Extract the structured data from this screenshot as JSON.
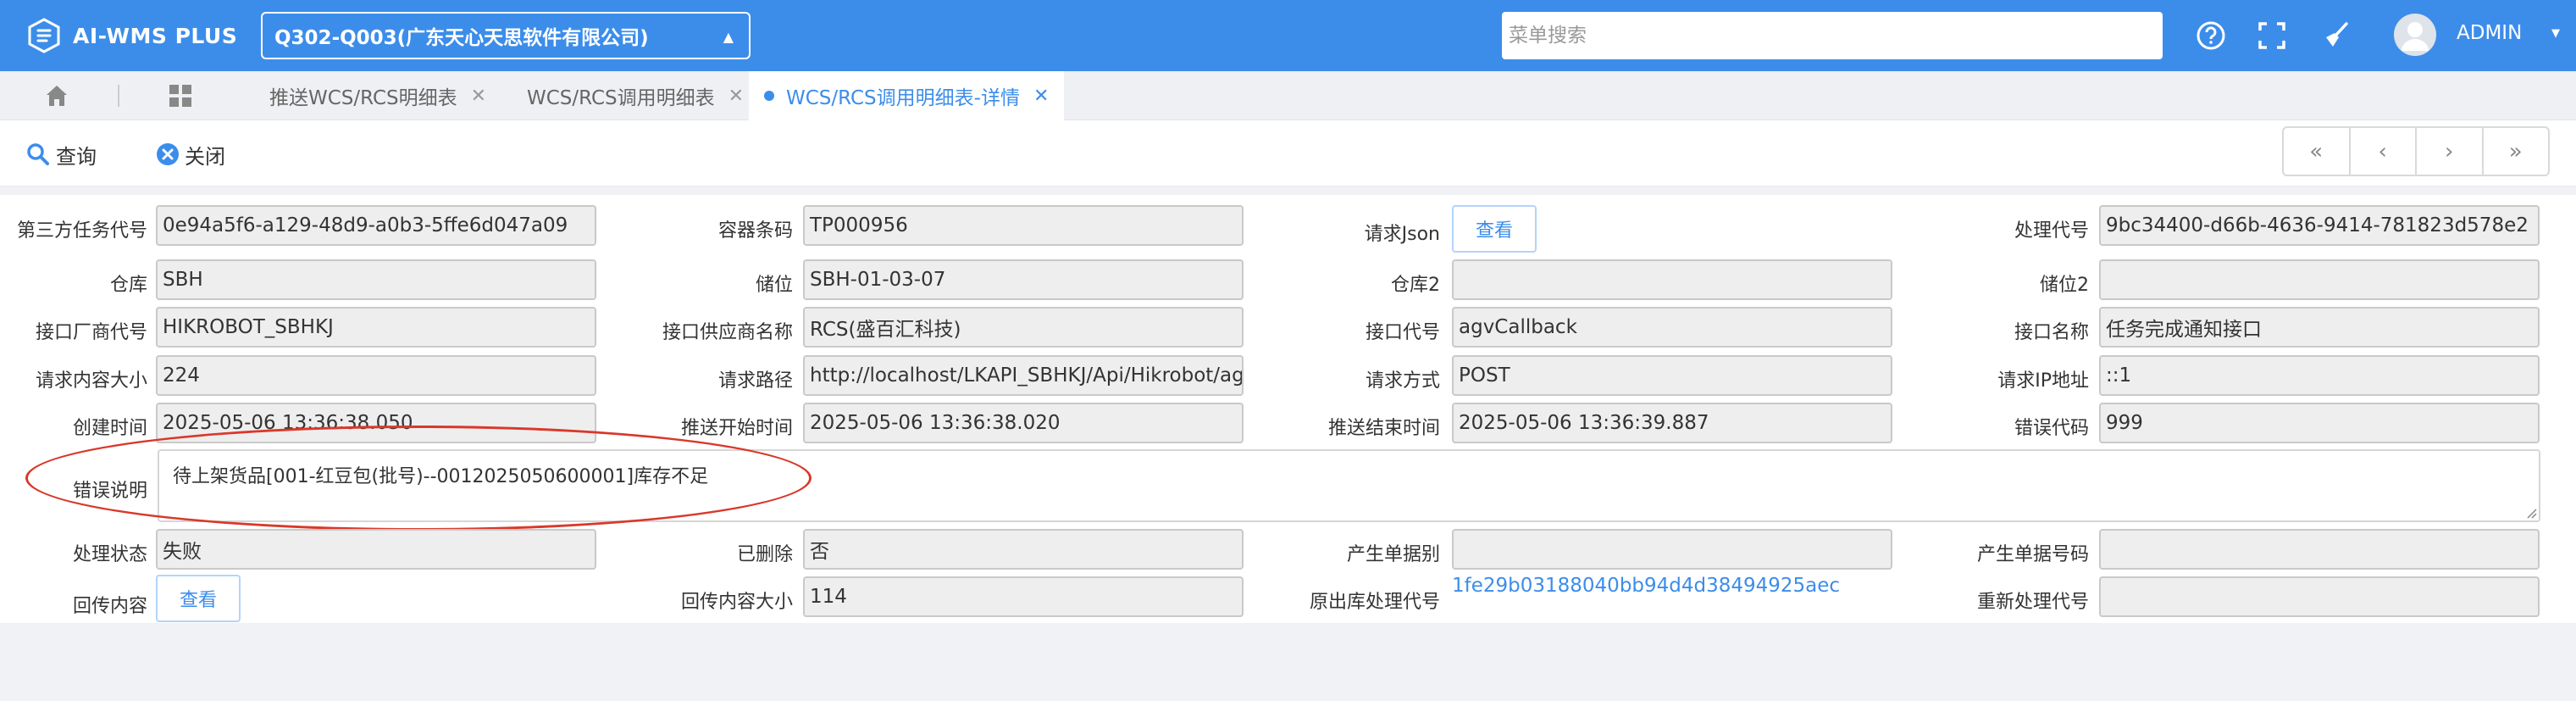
{
  "app": {
    "title": "AI-WMS PLUS",
    "company": "Q302-Q003(广东天心天思软件有限公司)"
  },
  "header": {
    "search_placeholder": "菜单搜索",
    "user": "ADMIN"
  },
  "tabs": [
    {
      "label": "推送WCS/RCS明细表",
      "active": false
    },
    {
      "label": "WCS/RCS调用明细表",
      "active": false
    },
    {
      "label": "WCS/RCS调用明细表-详情",
      "active": true
    }
  ],
  "toolbar": {
    "query": "查询",
    "close": "关闭"
  },
  "form": {
    "third_task_code": {
      "label": "第三方任务代号",
      "value": "0e94a5f6-a129-48d9-a0b3-5ffe6d047a09"
    },
    "container_barcode": {
      "label": "容器条码",
      "value": "TP000956"
    },
    "request_json": {
      "label": "请求Json",
      "button": "查看"
    },
    "process_code": {
      "label": "处理代号",
      "value": "9bc34400-d66b-4636-9414-781823d578e2"
    },
    "warehouse": {
      "label": "仓库",
      "value": "SBH"
    },
    "location": {
      "label": "储位",
      "value": "SBH-01-03-07"
    },
    "warehouse2": {
      "label": "仓库2",
      "value": ""
    },
    "location2": {
      "label": "储位2",
      "value": ""
    },
    "vendor_code": {
      "label": "接口厂商代号",
      "value": "HIKROBOT_SBHKJ"
    },
    "vendor_name": {
      "label": "接口供应商名称",
      "value": "RCS(盛百汇科技)"
    },
    "api_code": {
      "label": "接口代号",
      "value": "agvCallback"
    },
    "api_name": {
      "label": "接口名称",
      "value": "任务完成通知接口"
    },
    "req_size": {
      "label": "请求内容大小",
      "value": "224"
    },
    "req_path": {
      "label": "请求路径",
      "value": "http://localhost/LKAPI_SBHKJ/Api/Hikrobot/ag"
    },
    "req_method": {
      "label": "请求方式",
      "value": "POST"
    },
    "req_ip": {
      "label": "请求IP地址",
      "value": "::1"
    },
    "created_at": {
      "label": "创建时间",
      "value": "2025-05-06 13:36:38.050"
    },
    "push_start": {
      "label": "推送开始时间",
      "value": "2025-05-06 13:36:38.020"
    },
    "push_end": {
      "label": "推送结束时间",
      "value": "2025-05-06 13:36:39.887"
    },
    "error_code": {
      "label": "错误代码",
      "value": "999"
    },
    "error_desc": {
      "label": "错误说明",
      "value": "待上架货品[001-红豆包(批号)--0012025050600001]库存不足"
    },
    "status": {
      "label": "处理状态",
      "value": "失败"
    },
    "deleted": {
      "label": "已删除",
      "value": "否"
    },
    "doc_type": {
      "label": "产生单据别",
      "value": ""
    },
    "doc_no": {
      "label": "产生单据号码",
      "value": ""
    },
    "callback": {
      "label": "回传内容",
      "button": "查看"
    },
    "callback_size": {
      "label": "回传内容大小",
      "value": "114"
    },
    "orig_process_code": {
      "label": "原出库处理代号",
      "value": "1fe29b03188040bb94d4d38494925aec"
    },
    "reprocess_code": {
      "label": "重新处理代号",
      "value": ""
    }
  },
  "colors": {
    "primary": "#3c8dea",
    "highlight": "#d9382a"
  },
  "icons": [
    "logo-icon",
    "help-icon",
    "fullscreen-icon",
    "broom-icon",
    "home-icon",
    "grid-icon",
    "search-icon",
    "close-circle-icon"
  ]
}
